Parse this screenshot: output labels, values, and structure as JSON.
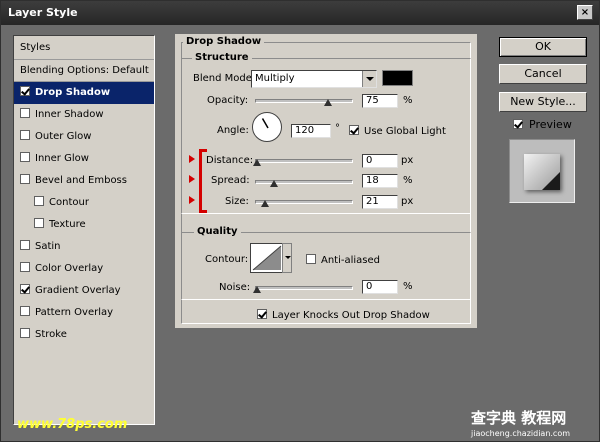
{
  "window": {
    "title": "Layer Style",
    "close_glyph": "×"
  },
  "styles_list": {
    "header": "Styles",
    "items": [
      {
        "label": "Blending Options: Default",
        "checkbox": false,
        "checked": false,
        "indent": false,
        "selected": false
      },
      {
        "label": "Drop Shadow",
        "checkbox": true,
        "checked": true,
        "indent": false,
        "selected": true
      },
      {
        "label": "Inner Shadow",
        "checkbox": true,
        "checked": false,
        "indent": false,
        "selected": false
      },
      {
        "label": "Outer Glow",
        "checkbox": true,
        "checked": false,
        "indent": false,
        "selected": false
      },
      {
        "label": "Inner Glow",
        "checkbox": true,
        "checked": false,
        "indent": false,
        "selected": false
      },
      {
        "label": "Bevel and Emboss",
        "checkbox": true,
        "checked": false,
        "indent": false,
        "selected": false
      },
      {
        "label": "Contour",
        "checkbox": true,
        "checked": false,
        "indent": true,
        "selected": false
      },
      {
        "label": "Texture",
        "checkbox": true,
        "checked": false,
        "indent": true,
        "selected": false
      },
      {
        "label": "Satin",
        "checkbox": true,
        "checked": false,
        "indent": false,
        "selected": false
      },
      {
        "label": "Color Overlay",
        "checkbox": true,
        "checked": false,
        "indent": false,
        "selected": false
      },
      {
        "label": "Gradient Overlay",
        "checkbox": true,
        "checked": true,
        "indent": false,
        "selected": false
      },
      {
        "label": "Pattern Overlay",
        "checkbox": true,
        "checked": false,
        "indent": false,
        "selected": false
      },
      {
        "label": "Stroke",
        "checkbox": true,
        "checked": false,
        "indent": false,
        "selected": false
      }
    ]
  },
  "drop_shadow": {
    "title": "Drop Shadow",
    "structure": {
      "title": "Structure",
      "blend_mode_label": "Blend Mode:",
      "blend_mode_value": "Multiply",
      "shadow_color": "#000000",
      "opacity_label": "Opacity:",
      "opacity_value": "75",
      "opacity_unit": "%",
      "opacity_fraction": 0.75,
      "angle_label": "Angle:",
      "angle_value": "120",
      "angle_deg": 120,
      "angle_unit": "°",
      "global_light_label": "Use Global Light",
      "global_light_checked": true,
      "distance_label": "Distance:",
      "distance_value": "0",
      "distance_unit": "px",
      "distance_fraction": 0.0,
      "spread_label": "Spread:",
      "spread_value": "18",
      "spread_unit": "%",
      "spread_fraction": 0.18,
      "size_label": "Size:",
      "size_value": "21",
      "size_unit": "px",
      "size_fraction": 0.08
    },
    "quality": {
      "title": "Quality",
      "contour_label": "Contour:",
      "anti_aliased_label": "Anti-aliased",
      "anti_aliased_checked": false,
      "noise_label": "Noise:",
      "noise_value": "0",
      "noise_unit": "%",
      "noise_fraction": 0.0
    },
    "knockout_label": "Layer Knocks Out Drop Shadow",
    "knockout_checked": true
  },
  "buttons": {
    "ok": "OK",
    "cancel": "Cancel",
    "new_style": "New Style..."
  },
  "preview": {
    "label": "Preview",
    "checked": true
  },
  "watermarks": {
    "left": "www.78ps.com",
    "right_big": "查字典 教程网",
    "right_small": "jiaocheng.chazidian.com"
  },
  "colors": {
    "accent": "#d40000",
    "selection": "#0a246a"
  }
}
